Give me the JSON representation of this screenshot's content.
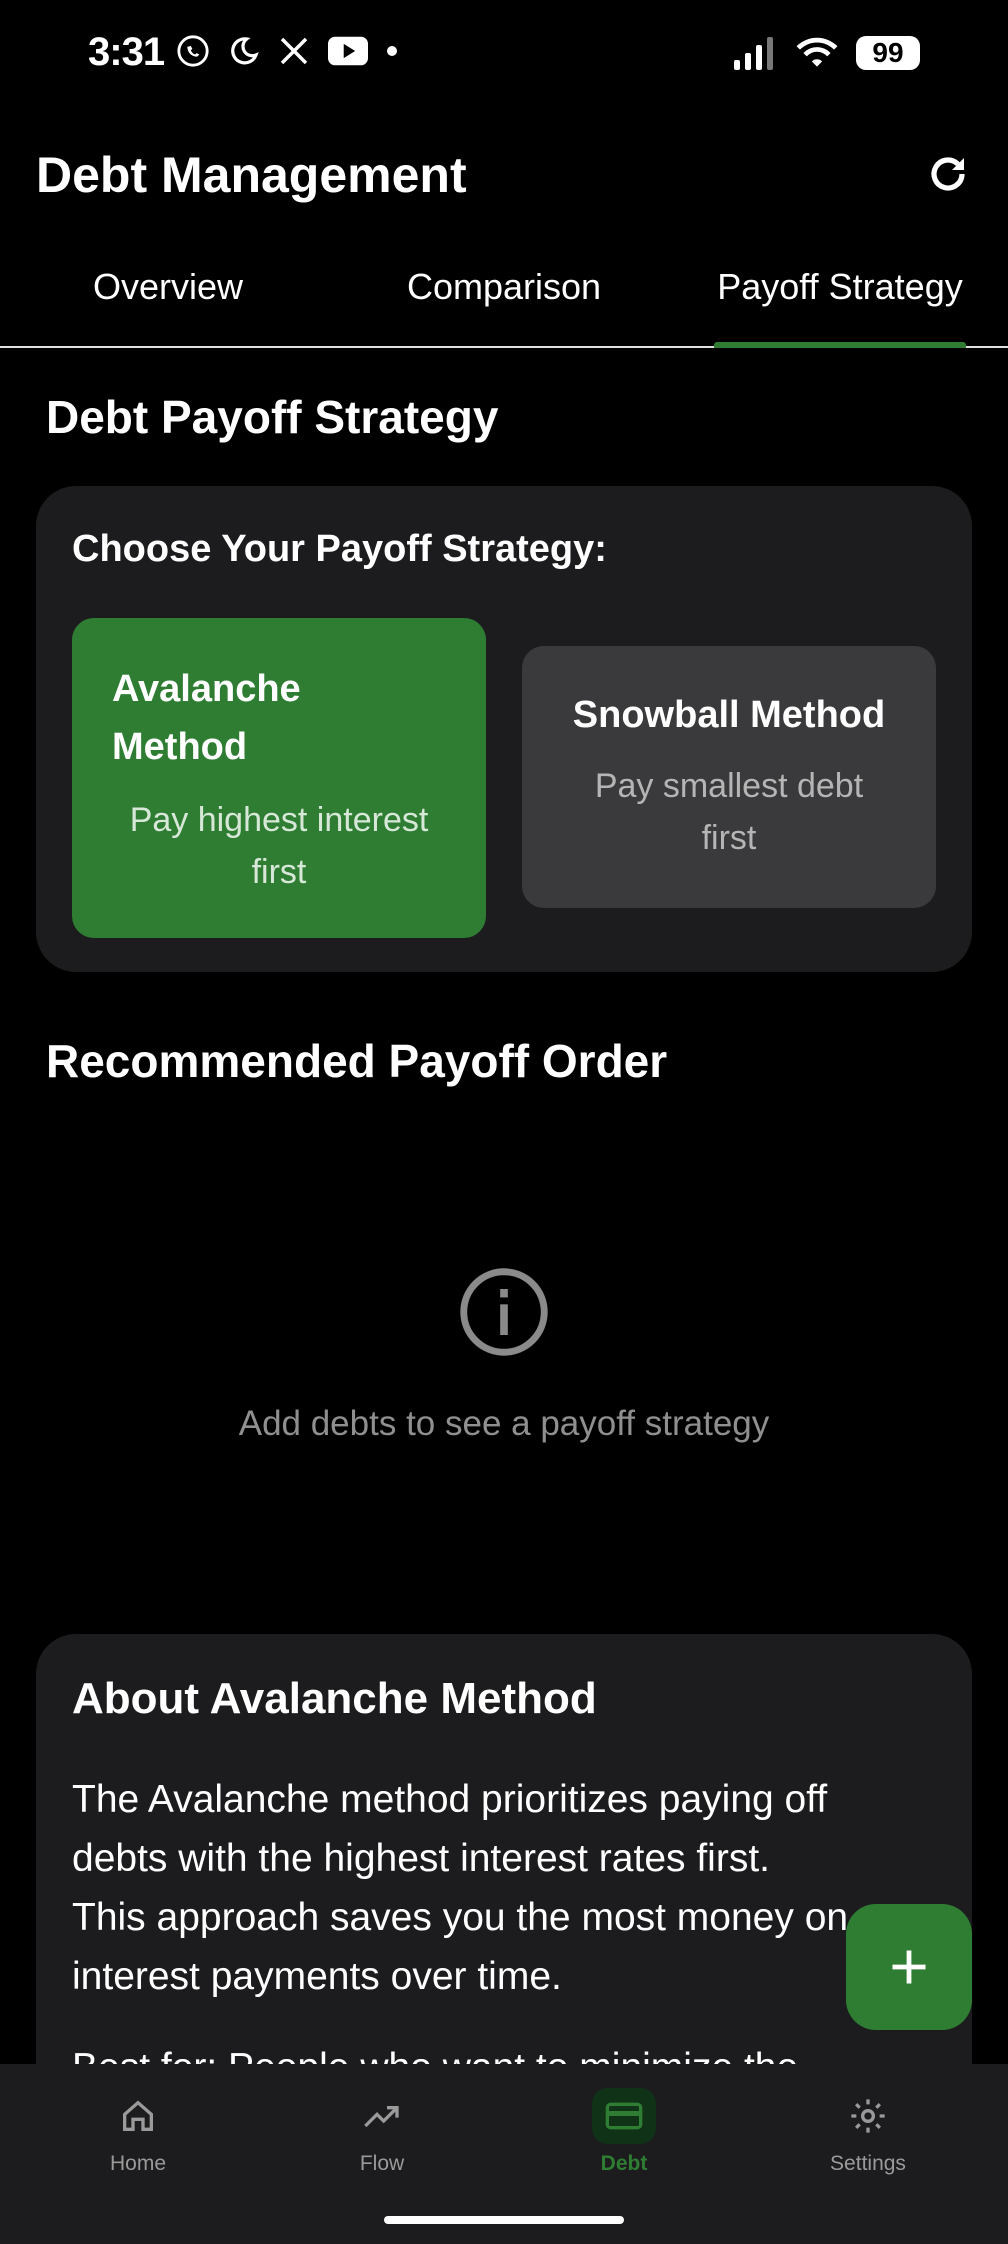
{
  "status_bar": {
    "time": "3:31",
    "battery": "99"
  },
  "header": {
    "title": "Debt Management"
  },
  "tabs": [
    {
      "label": "Overview"
    },
    {
      "label": "Comparison"
    },
    {
      "label": "Payoff Strategy",
      "active": true
    }
  ],
  "strategy": {
    "section_title": "Debt Payoff Strategy",
    "choose_heading": "Choose Your Payoff Strategy:",
    "methods": [
      {
        "title_line1": "Avalanche",
        "title_line2": "Method",
        "desc_line1": "Pay highest interest",
        "desc_line2": "first",
        "selected": true
      },
      {
        "title": "Snowball Method",
        "desc_line1": "Pay smallest debt",
        "desc_line2": "first",
        "selected": false
      }
    ]
  },
  "payoff_order": {
    "title": "Recommended Payoff Order",
    "empty_message": "Add debts to see a payoff strategy"
  },
  "about": {
    "title": "About Avalanche Method",
    "body_lines": [
      "The Avalanche method prioritizes paying off",
      "debts with the highest interest rates first.",
      "This approach saves you the most money on",
      "interest payments over time.",
      "Best for: People who want to minimize the"
    ]
  },
  "bottom_nav": [
    {
      "label": "Home",
      "icon": "home-icon"
    },
    {
      "label": "Flow",
      "icon": "trending-up-icon"
    },
    {
      "label": "Debt",
      "icon": "credit-card-icon",
      "active": true
    },
    {
      "label": "Settings",
      "icon": "gear-icon"
    }
  ],
  "colors": {
    "accent": "#2e7d32",
    "card": "#1c1c1e",
    "background": "#000000"
  }
}
